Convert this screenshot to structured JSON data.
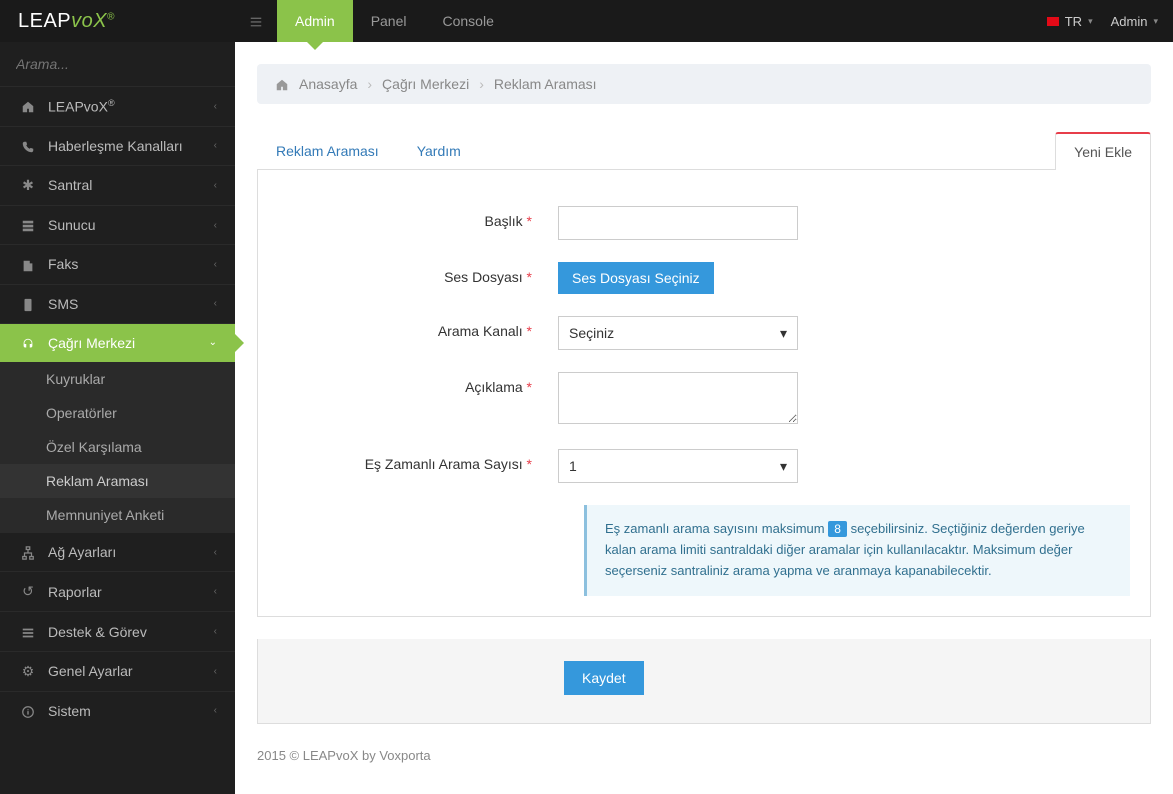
{
  "header": {
    "brand_leap": "LEAP",
    "brand_vox": "voX",
    "brand_reg": "®",
    "top_nav": [
      {
        "label": "Admin",
        "active": true
      },
      {
        "label": "Panel"
      },
      {
        "label": "Console"
      }
    ],
    "lang_label": "TR",
    "user_label": "Admin"
  },
  "sidebar": {
    "search_placeholder": "Arama...",
    "items": [
      {
        "label": "LEAPvoX®"
      },
      {
        "label": "Haberleşme Kanalları"
      },
      {
        "label": "Santral"
      },
      {
        "label": "Sunucu"
      },
      {
        "label": "Faks"
      },
      {
        "label": "SMS"
      },
      {
        "label": "Çağrı Merkezi",
        "active": true
      },
      {
        "label": "Ağ Ayarları"
      },
      {
        "label": "Raporlar"
      },
      {
        "label": "Destek & Görev"
      },
      {
        "label": "Genel Ayarlar"
      },
      {
        "label": "Sistem"
      }
    ],
    "subitems": [
      {
        "label": "Kuyruklar"
      },
      {
        "label": "Operatörler"
      },
      {
        "label": "Özel Karşılama"
      },
      {
        "label": "Reklam Araması",
        "current": true
      },
      {
        "label": "Memnuniyet Anketi"
      }
    ]
  },
  "breadcrumb": {
    "home": "Anasayfa",
    "level1": "Çağrı Merkezi",
    "level2": "Reklam Araması"
  },
  "tabs": {
    "t1": "Reklam Araması",
    "t2": "Yardım",
    "t3": "Yeni Ekle"
  },
  "form": {
    "title_label": "Başlık",
    "sound_label": "Ses Dosyası",
    "sound_button": "Ses Dosyası Seçiniz",
    "channel_label": "Arama Kanalı",
    "channel_value": "Seçiniz",
    "description_label": "Açıklama",
    "concurrent_label": "Eş Zamanlı Arama Sayısı",
    "concurrent_value": "1",
    "alert_pre": "Eş zamanlı arama sayısını maksimum",
    "alert_badge": "8",
    "alert_post": "seçebilirsiniz. Seçtiğiniz değerden geriye kalan arama limiti santraldaki diğer aramalar için kullanılacaktır. Maksimum değer seçerseniz santraliniz arama yapma ve aranmaya kapanabilecektir.",
    "save_button": "Kaydet"
  },
  "footer": {
    "text": "2015 © LEAPvoX by Voxporta"
  }
}
